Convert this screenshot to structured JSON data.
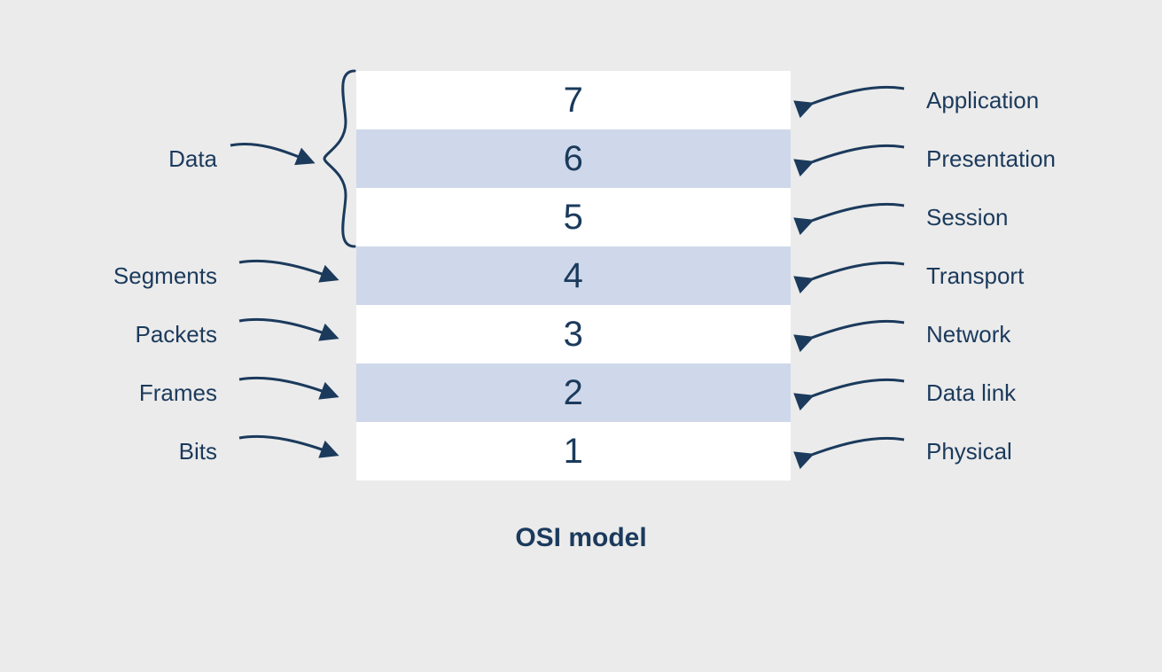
{
  "title": "OSI model",
  "layers": [
    {
      "number": "7",
      "name": "Application",
      "data_unit": "Data",
      "shade": "white"
    },
    {
      "number": "6",
      "name": "Presentation",
      "data_unit": "Data",
      "shade": "alt"
    },
    {
      "number": "5",
      "name": "Session",
      "data_unit": "Data",
      "shade": "white"
    },
    {
      "number": "4",
      "name": "Transport",
      "data_unit": "Segments",
      "shade": "alt"
    },
    {
      "number": "3",
      "name": "Network",
      "data_unit": "Packets",
      "shade": "white"
    },
    {
      "number": "2",
      "name": "Data link",
      "data_unit": "Frames",
      "shade": "alt"
    },
    {
      "number": "1",
      "name": "Physical",
      "data_unit": "Bits",
      "shade": "white"
    }
  ],
  "left_group": {
    "label": "Data",
    "covers_layers": [
      "7",
      "6",
      "5"
    ]
  },
  "left_singles": [
    {
      "label": "Segments",
      "layer": "4"
    },
    {
      "label": "Packets",
      "layer": "3"
    },
    {
      "label": "Frames",
      "layer": "2"
    },
    {
      "label": "Bits",
      "layer": "1"
    }
  ],
  "colors": {
    "text": "#1b3a5c",
    "stroke": "#1b3a5c",
    "bg": "#ebebeb",
    "row_alt": "#ced8ea",
    "row_white": "#ffffff"
  }
}
